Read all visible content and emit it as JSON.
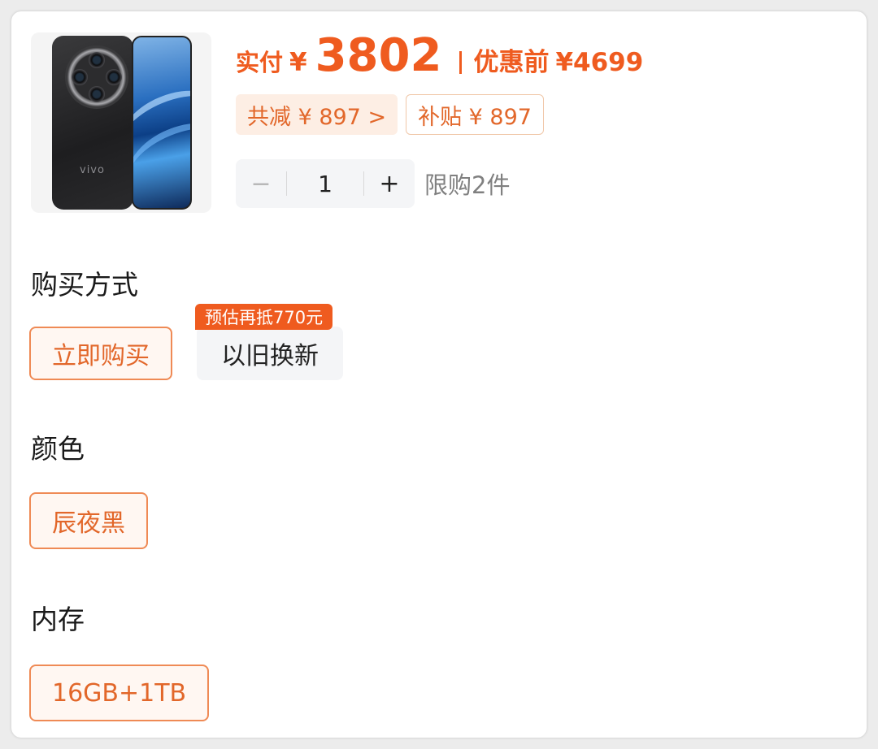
{
  "product": {
    "image_icon": "phone-product-image",
    "brand_mark": "vivo"
  },
  "price": {
    "pay_label": "实付",
    "currency": "¥",
    "actual": "3802",
    "original_label": "优惠前",
    "original": "¥4699"
  },
  "tags": {
    "total_discount": "共减 ¥ 897 >",
    "subsidy": "补贴 ¥ 897"
  },
  "quantity": {
    "minus": "−",
    "value": "1",
    "plus": "+",
    "limit": "限购2件"
  },
  "purchase_method": {
    "title": "购买方式",
    "options": [
      "立即购买",
      "以旧换新"
    ],
    "selected": "立即购买",
    "tradein_badge": "预估再抵770元"
  },
  "color": {
    "title": "颜色",
    "options": [
      "辰夜黑"
    ],
    "selected": "辰夜黑"
  },
  "memory": {
    "title": "内存",
    "options": [
      "16GB+1TB"
    ],
    "selected": "16GB+1TB"
  },
  "colors": {
    "accent": "#ef5b1f",
    "tag_text": "#e2672a",
    "selected_border": "#ef8a55"
  }
}
